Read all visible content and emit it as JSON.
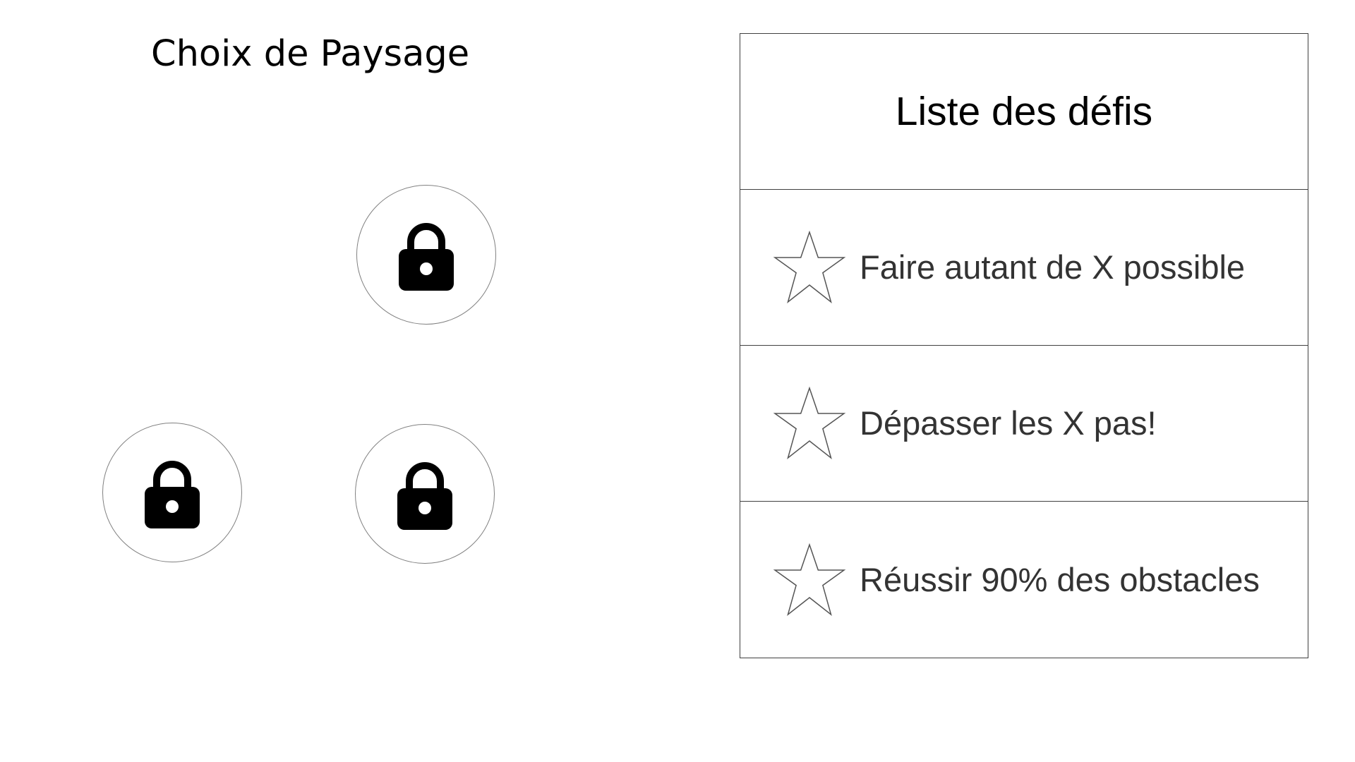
{
  "page": {
    "title": "Choix de Paysage"
  },
  "landscapes": [
    {
      "icon": "lock-icon",
      "locked": true
    },
    {
      "icon": "lock-icon",
      "locked": true
    },
    {
      "icon": "lock-icon",
      "locked": true
    }
  ],
  "challenges": {
    "title": "Liste des défis",
    "items": [
      {
        "label": "Faire autant de X possible",
        "icon": "star-outline-icon"
      },
      {
        "label": "Dépasser les X pas!",
        "icon": "star-outline-icon"
      },
      {
        "label": "Réussir 90% des obstacles",
        "icon": "star-outline-icon"
      }
    ]
  },
  "colors": {
    "background": "#ffffff",
    "text": "#000000",
    "challenge_text": "#333333",
    "border": "#404040",
    "circle_border": "#808080"
  }
}
